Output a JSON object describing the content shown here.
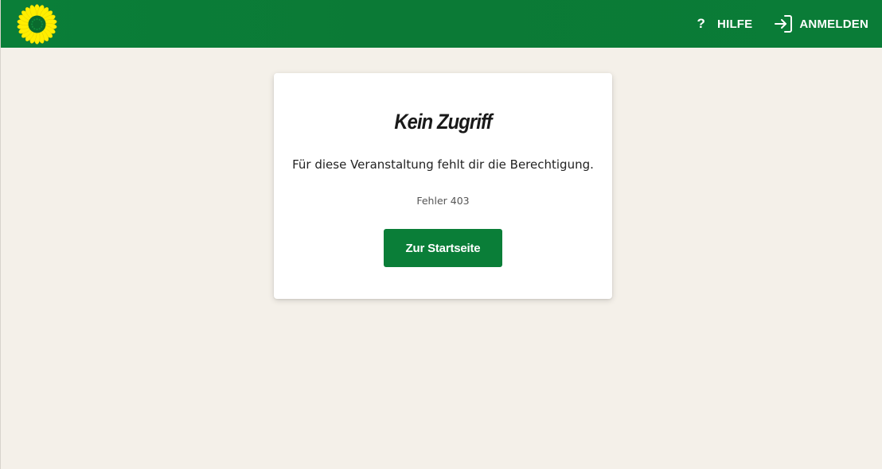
{
  "header": {
    "logo_icon": "sunflower-icon",
    "help_icon": "question-mark-icon",
    "help_label": "HILFE",
    "login_icon": "sign-in-arrow-icon",
    "login_label": "ANMELDEN"
  },
  "card": {
    "title": "Kein Zugriff",
    "message": "Für diese Veranstaltung fehlt dir die Berechtigung.",
    "error_code": "Fehler 403",
    "button_label": "Zur Startseite"
  },
  "colors": {
    "brand_green": "#0a7e38",
    "page_background": "#f4f0e9",
    "logo_yellow": "#ffee00"
  }
}
